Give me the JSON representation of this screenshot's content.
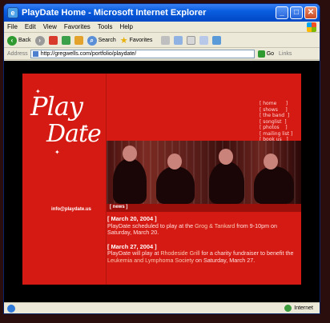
{
  "window": {
    "title": "PlayDate Home - Microsoft Internet Explorer",
    "controls": [
      "_",
      "□",
      "✕"
    ]
  },
  "menu": [
    "File",
    "Edit",
    "View",
    "Favorites",
    "Tools",
    "Help"
  ],
  "toolbar": {
    "back_label": "Back",
    "search_label": "Search",
    "favorites_label": "Favorites"
  },
  "address": {
    "label": "Address",
    "url": "http://gregwells.com/portfolio/playdate/",
    "go_label": "Go",
    "links_label": "Links"
  },
  "site": {
    "logo_top": "Play",
    "logo_bottom": "Date",
    "nav": [
      "[ home      ]",
      "[ shows     ]",
      "[ the band  ]",
      "[ songlist  ]",
      "[ photos    ]",
      "[ mailing list ]",
      "[ book us   ]"
    ],
    "email": "info@playdate.us",
    "news_label": "[ news ]",
    "news": [
      {
        "date": "[ March 20, 2004 ]",
        "text_before": "PlayDate scheduled to play at the ",
        "venue": "Grog & Tankard",
        "text_after": " from 9-10pm on Saturday, March 20."
      },
      {
        "date": "[ March 27, 2004 ]",
        "text_before": "PlayDate will play at ",
        "venue": "Rhodeside Grill",
        "text_middle": " for a charity fundraiser to benefit the ",
        "venue2": "Leukemia and Lymphoma Society",
        "text_after": " on Saturday, March 27."
      }
    ]
  },
  "status": {
    "zone": "Internet"
  },
  "colors": {
    "site_red": "#d41a13",
    "news_bar": "#9c100b"
  }
}
